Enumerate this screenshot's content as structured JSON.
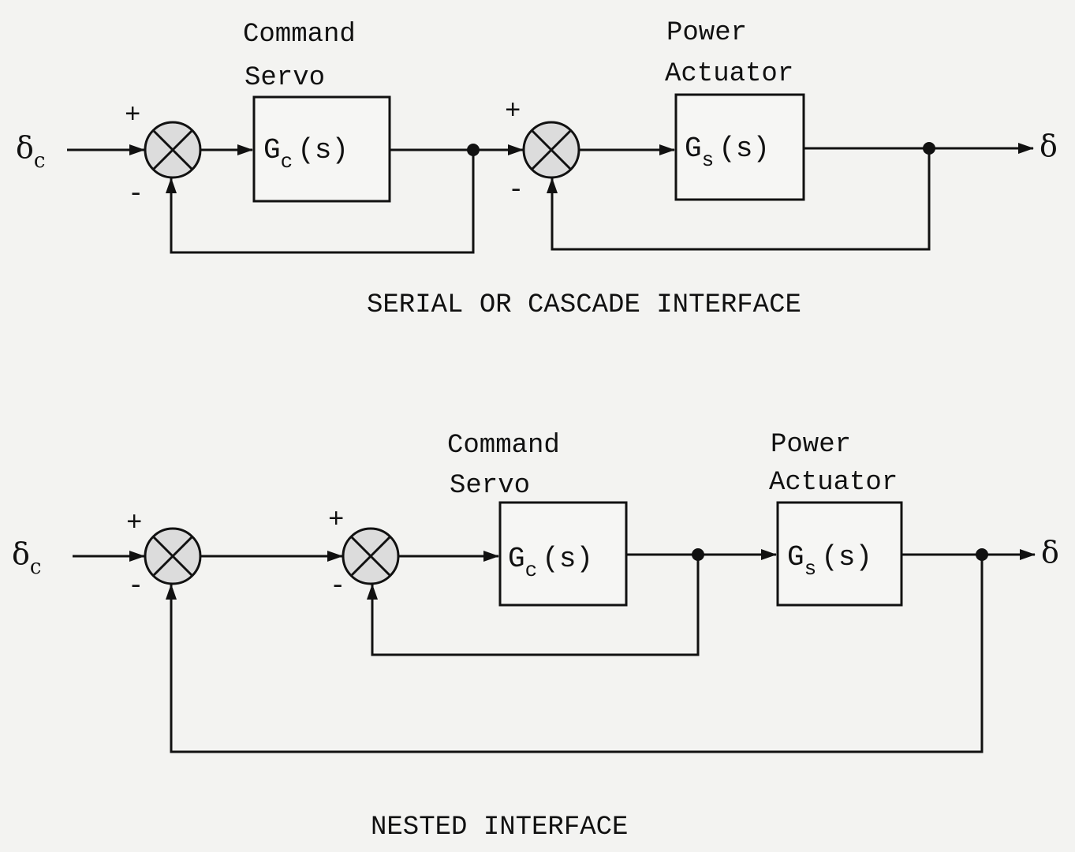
{
  "serial": {
    "caption": "SERIAL OR CASCADE INTERFACE",
    "input": "δ",
    "input_sub": "c",
    "output": "δ",
    "block1": {
      "label1": "Command",
      "label2": "Servo",
      "tf": "G",
      "tf_sub": "c",
      "tf_arg": "(s)"
    },
    "block2": {
      "label1": "Power",
      "label2": "Actuator",
      "tf": "G",
      "tf_sub": "s",
      "tf_arg": "(s)"
    },
    "plus": "+",
    "minus": "-"
  },
  "nested": {
    "caption": "NESTED INTERFACE",
    "input": "δ",
    "input_sub": "c",
    "output": "δ",
    "block1": {
      "label1": "Command",
      "label2": "Servo",
      "tf": "G",
      "tf_sub": "c",
      "tf_arg": "(s)"
    },
    "block2": {
      "label1": "Power",
      "label2": "Actuator",
      "tf": "G",
      "tf_sub": "s",
      "tf_arg": "(s)"
    },
    "plus": "+",
    "minus": "-"
  }
}
